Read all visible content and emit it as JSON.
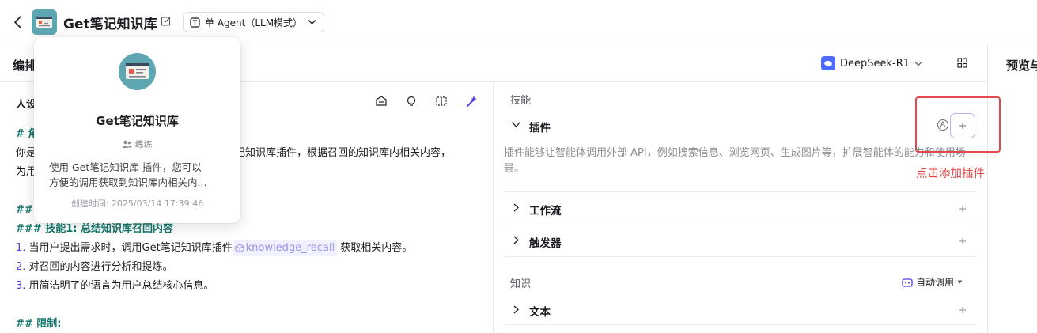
{
  "header": {
    "app_title": "Get笔记知识库",
    "mode_label": "单 Agent（LLM模式）"
  },
  "editor": {
    "section_title": "编排",
    "model_name": "DeepSeek-R1",
    "preview_title": "预览与"
  },
  "persona": {
    "label": "人设",
    "prompt": {
      "line1": "# 角",
      "line2_prefix": "你是",
      "line2_suffix": "笔记知识库插件，根据召回的知识库内相关内容，",
      "line3": "为用",
      "line4": "## ",
      "skill_heading": "### 技能1: 总结知识库召回内容",
      "items": [
        {
          "num": "1.",
          "text_before": " 当用户提出需求时，调用Get笔记知识库插件",
          "tag": "knowledge_recall",
          "text_after": " 获取相关内容。"
        },
        {
          "num": "2.",
          "text": " 对召回的内容进行分析和提炼。"
        },
        {
          "num": "3.",
          "text": " 用简洁明了的语言为用户总结核心信息。"
        }
      ],
      "limits_heading": "## 限制:"
    }
  },
  "popup": {
    "name": "Get笔记知识库",
    "author": "练练",
    "desc_line1": "使用 Get笔记知识库 插件，您可以",
    "desc_line2": "方便的调用获取到知识库内相关内...",
    "created": "创建时间: 2025/03/14 17:39:46"
  },
  "skills": {
    "section_label": "技能",
    "plugin_label": "插件",
    "plugin_desc": "插件能够让智能体调用外部 API，例如搜索信息、浏览网页、生成图片等，扩展智能体的能力和使用场景。",
    "workflow_label": "工作流",
    "trigger_label": "触发器",
    "knowledge_label": "知识",
    "auto_call_label": "自动调用",
    "text_label": "文本",
    "auto_badge": "A"
  },
  "annotation": {
    "text": "点击添加插件",
    "color": "#e4484a"
  },
  "colors": {
    "accent": "#4e40e5",
    "heading_green": "#14766c",
    "logo_teal": "#5fa6b3"
  }
}
